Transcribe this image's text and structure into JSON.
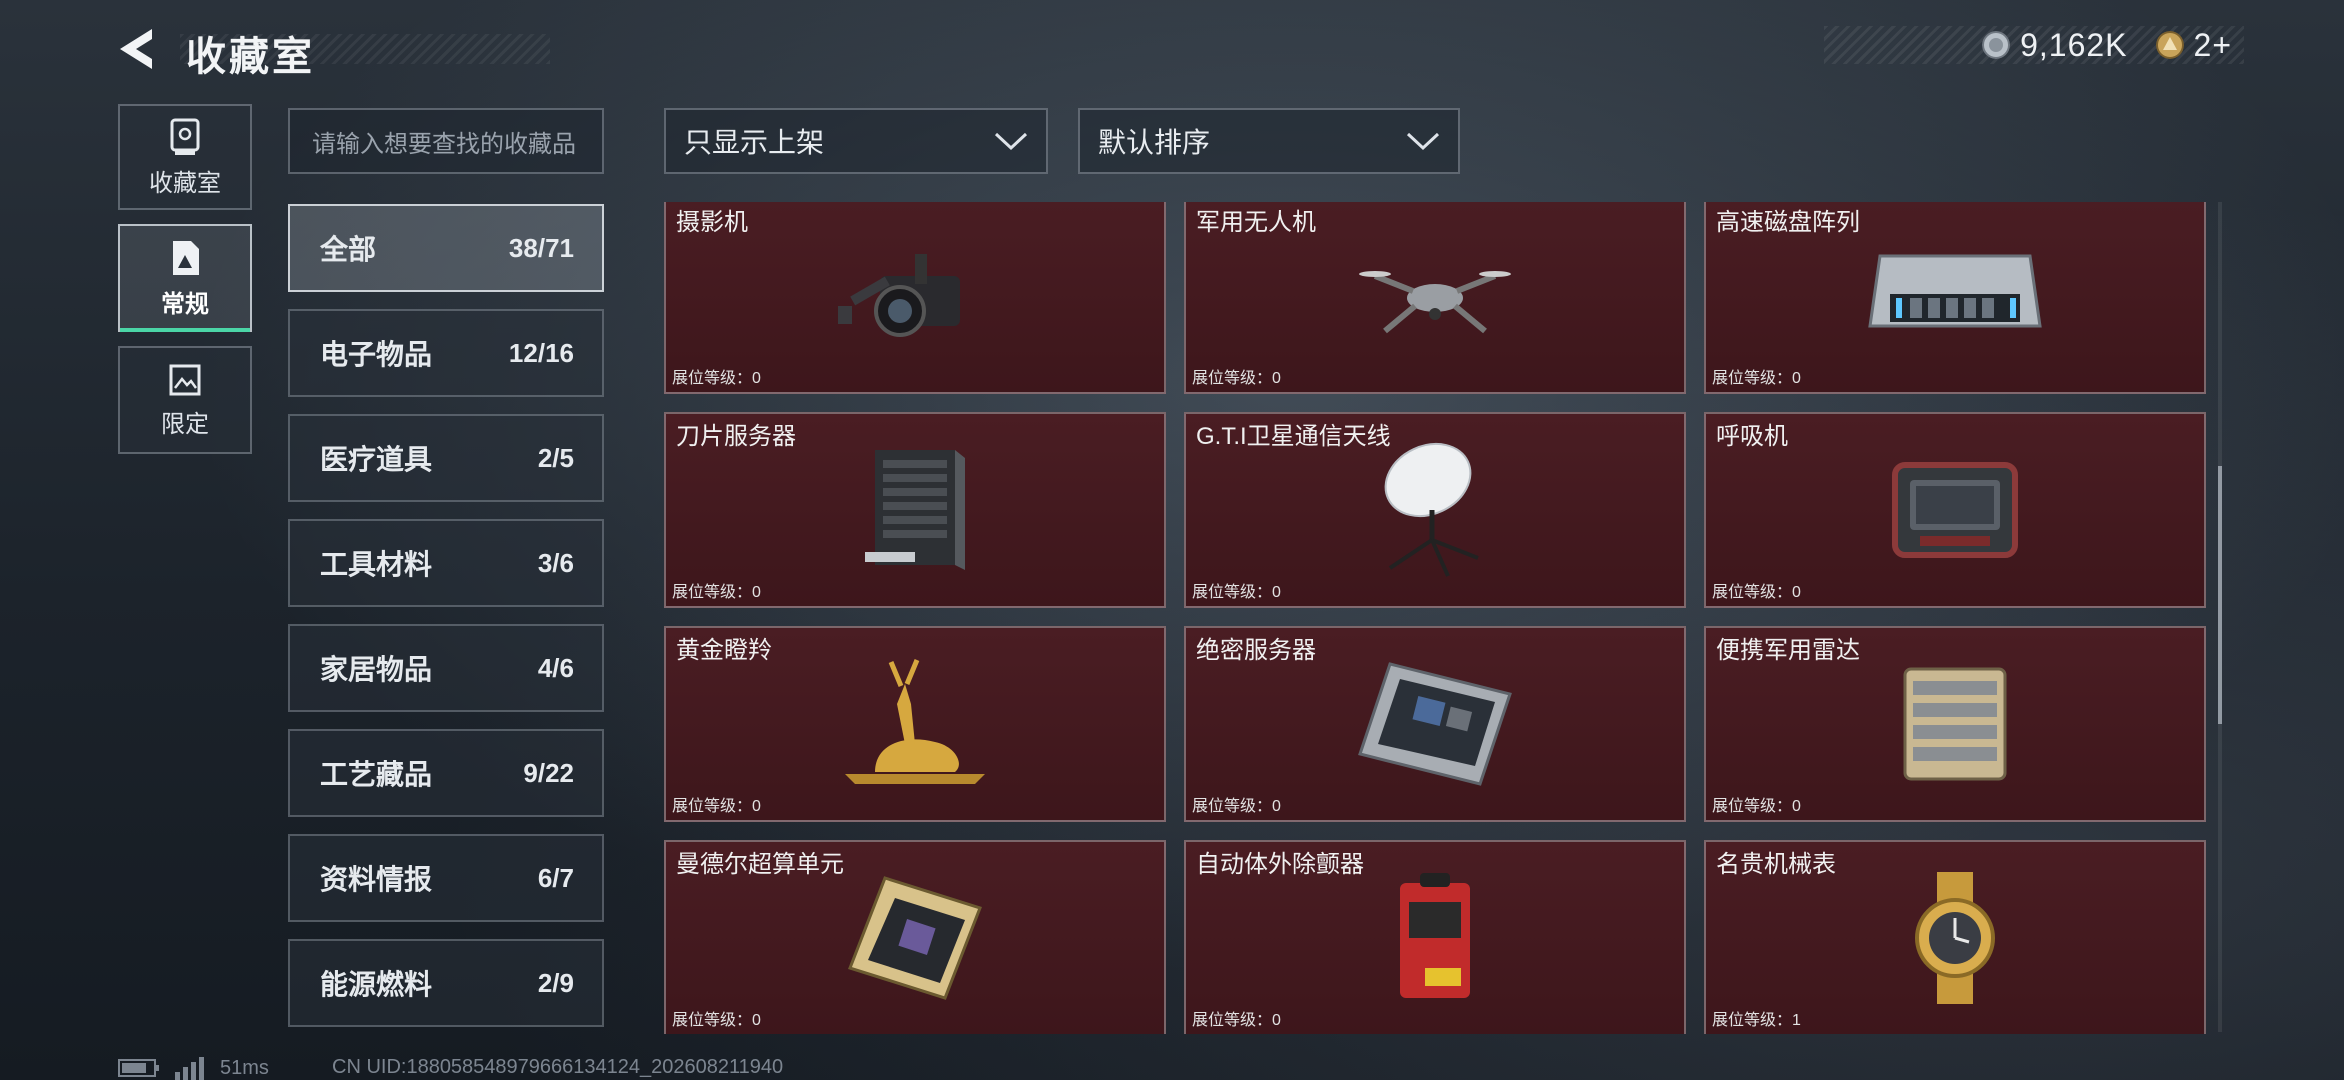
{
  "header": {
    "title": "收藏室",
    "currency1": "9,162K",
    "currency2": "2+"
  },
  "sidebar": {
    "tabs": [
      {
        "label": "收藏室",
        "icon": "vault-icon",
        "active": false
      },
      {
        "label": "常规",
        "icon": "document-icon",
        "active": true
      },
      {
        "label": "限定",
        "icon": "picture-icon",
        "active": false
      }
    ]
  },
  "search": {
    "placeholder": "请输入想要查找的收藏品"
  },
  "filters": {
    "shelf_filter": "只显示上架",
    "sort": "默认排序"
  },
  "categories": [
    {
      "label": "全部",
      "count": "38/71",
      "active": true
    },
    {
      "label": "电子物品",
      "count": "12/16",
      "active": false
    },
    {
      "label": "医疗道具",
      "count": "2/5",
      "active": false
    },
    {
      "label": "工具材料",
      "count": "3/6",
      "active": false
    },
    {
      "label": "家居物品",
      "count": "4/6",
      "active": false
    },
    {
      "label": "工艺藏品",
      "count": "9/22",
      "active": false
    },
    {
      "label": "资料情报",
      "count": "6/7",
      "active": false
    },
    {
      "label": "能源燃料",
      "count": "2/9",
      "active": false
    }
  ],
  "items": [
    {
      "name": "摄影机",
      "level": "展位等级：0",
      "icon": "camera-icon"
    },
    {
      "name": "军用无人机",
      "level": "展位等级：0",
      "icon": "drone-icon"
    },
    {
      "name": "高速磁盘阵列",
      "level": "展位等级：0",
      "icon": "disk-array-icon"
    },
    {
      "name": "刀片服务器",
      "level": "展位等级：0",
      "icon": "blade-server-icon"
    },
    {
      "name": "G.T.I卫星通信天线",
      "level": "展位等级：0",
      "icon": "satellite-dish-icon"
    },
    {
      "name": "呼吸机",
      "level": "展位等级：0",
      "icon": "ventilator-icon"
    },
    {
      "name": "黄金瞪羚",
      "level": "展位等级：0",
      "icon": "gold-gazelle-icon"
    },
    {
      "name": "绝密服务器",
      "level": "展位等级：0",
      "icon": "secret-server-icon"
    },
    {
      "name": "便携军用雷达",
      "level": "展位等级：0",
      "icon": "portable-radar-icon"
    },
    {
      "name": "曼德尔超算单元",
      "level": "展位等级：0",
      "icon": "supercomputer-unit-icon"
    },
    {
      "name": "自动体外除颤器",
      "level": "展位等级：0",
      "icon": "defibrillator-icon"
    },
    {
      "name": "名贵机械表",
      "level": "展位等级：1",
      "icon": "luxury-watch-icon"
    }
  ],
  "status": {
    "ping": "51ms",
    "uid": "CN UID:1880585489796661341​24_202608211940"
  }
}
